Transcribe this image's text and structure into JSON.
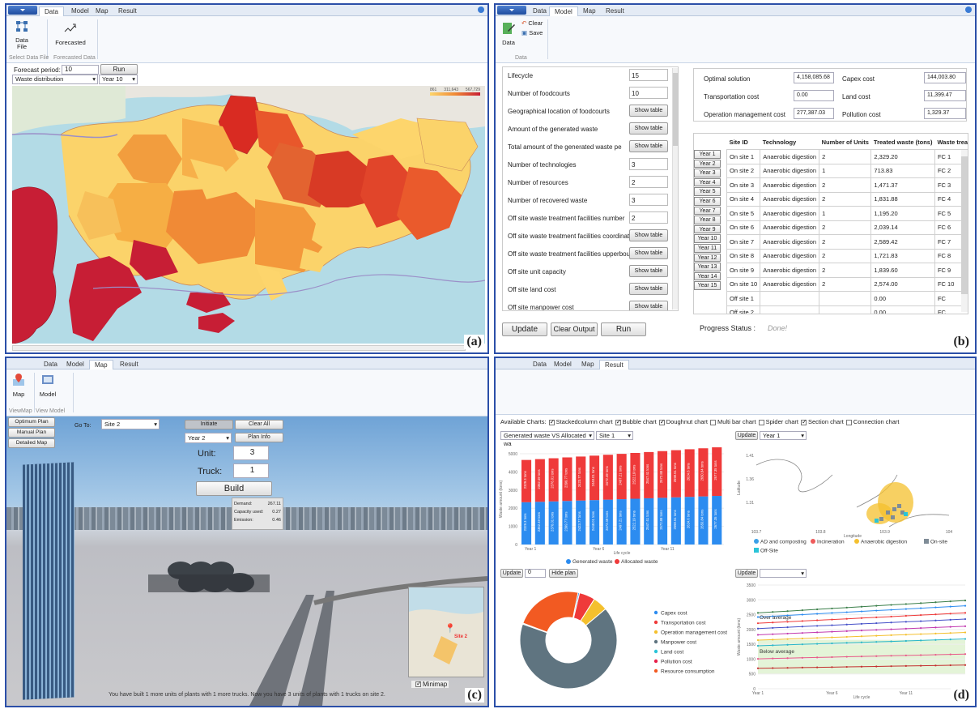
{
  "panel_a": {
    "tabs": [
      "Data",
      "Model",
      "Map",
      "Result"
    ],
    "ribbon": {
      "data_file": "Data\nFile",
      "forecasted": "Forecasted",
      "group1": "Select Data File",
      "group2": "Forecasted Data"
    },
    "forecast_label": "Forecast period:",
    "forecast_value": "10",
    "run": "Run",
    "dist_select": "Waste distribution",
    "year_select": "Year 10",
    "legend_ticks": [
      "861",
      "311,643",
      "567,729"
    ],
    "label": "(a)"
  },
  "panel_b": {
    "tabs": [
      "Data",
      "Model",
      "Map",
      "Result"
    ],
    "ribbon": {
      "data": "Data",
      "clear": "Clear",
      "save": "Save",
      "group": "Data"
    },
    "params": [
      {
        "label": "Lifecycle",
        "value": "15"
      },
      {
        "label": "Number of foodcourts",
        "value": "10"
      },
      {
        "label": "Geographical location of foodcourts",
        "button": "Show table"
      },
      {
        "label": "Amount of the generated waste",
        "button": "Show table"
      },
      {
        "label": "Total amount of the generated waste pe",
        "button": "Show table"
      },
      {
        "label": "Number of technologies",
        "value": "3"
      },
      {
        "label": "Number of resources",
        "value": "2"
      },
      {
        "label": "Number of recovered waste",
        "value": "3"
      },
      {
        "label": "Off site waste treatment facilities number",
        "value": "2"
      },
      {
        "label": "Off site waste treatment facilities coordinat",
        "button": "Show table"
      },
      {
        "label": "Off site waste treatment facilities upperbou",
        "button": "Show table"
      },
      {
        "label": "Off site unit capacity",
        "button": "Show table"
      },
      {
        "label": "Off site land cost",
        "button": "Show table"
      },
      {
        "label": "Off site manpower cost",
        "button": "Show table"
      }
    ],
    "costs": {
      "optimal_label": "Optimal solution",
      "optimal": "4,158,085.68",
      "capex_label": "Capex cost",
      "capex": "144,003.80",
      "transport_label": "Transportation cost",
      "transport": "0.00",
      "land_label": "Land cost",
      "land": "11,399.47",
      "operation_label": "Operation management cost",
      "operation": "277,387.03",
      "pollution_label": "Pollution cost",
      "pollution": "1,329.37"
    },
    "table_headers": [
      "Site ID",
      "Technology",
      "Number of Units",
      "Treated waste (tons)",
      "Waste treated from"
    ],
    "years": [
      "Year 1",
      "Year 2",
      "Year 3",
      "Year 4",
      "Year 5",
      "Year 6",
      "Year 7",
      "Year 8",
      "Year 9",
      "Year 10",
      "Year 11",
      "Year 12",
      "Year 13",
      "Year 14",
      "Year 15"
    ],
    "rows": [
      [
        "On site 1",
        "Anaerobic digestion",
        "2",
        "2,329.20",
        "FC 1"
      ],
      [
        "On site 2",
        "Anaerobic digestion",
        "1",
        "713.83",
        "FC 2"
      ],
      [
        "On site 3",
        "Anaerobic digestion",
        "2",
        "1,471.37",
        "FC 3"
      ],
      [
        "On site 4",
        "Anaerobic digestion",
        "2",
        "1,831.88",
        "FC 4"
      ],
      [
        "On site 5",
        "Anaerobic digestion",
        "1",
        "1,195.20",
        "FC 5"
      ],
      [
        "On site 6",
        "Anaerobic digestion",
        "2",
        "2,039.14",
        "FC 6"
      ],
      [
        "On site 7",
        "Anaerobic digestion",
        "2",
        "2,589.42",
        "FC 7"
      ],
      [
        "On site 8",
        "Anaerobic digestion",
        "2",
        "1,721.83",
        "FC 8"
      ],
      [
        "On site 9",
        "Anaerobic digestion",
        "2",
        "1,839.60",
        "FC 9"
      ],
      [
        "On site 10",
        "Anaerobic digestion",
        "2",
        "2,574.00",
        "FC 10"
      ],
      [
        "Off site 1",
        "",
        "",
        "0.00",
        "FC"
      ],
      [
        "Off site 2",
        "",
        "",
        "0.00",
        "FC"
      ]
    ],
    "update": "Update",
    "clear_output": "Clear Output",
    "run": "Run",
    "progress_label": "Progress Status :",
    "progress_value": "Done!",
    "label": "(b)"
  },
  "panel_c": {
    "tabs": [
      "Data",
      "Model",
      "Map",
      "Result"
    ],
    "ribbon": {
      "map": "Map",
      "model": "Model",
      "group1": "ViewMap",
      "group2": "View Model"
    },
    "left_buttons": [
      "Optimum Plan",
      "Manual Plan",
      "Detailed Map"
    ],
    "goto_label": "Go To:",
    "goto_value": "Site 2",
    "initiate": "Initiate",
    "clear_all": "Clear All",
    "year_value": "Year 2",
    "plan_info": "Plan Info",
    "unit_label": "Unit:",
    "unit_value": "3",
    "truck_label": "Truck:",
    "truck_value": "1",
    "build": "Build",
    "info": [
      {
        "k": "Demand:",
        "v": "267.11"
      },
      {
        "k": "Capacity used:",
        "v": "0.27"
      },
      {
        "k": "Emission:",
        "v": "0.46"
      }
    ],
    "minimap_label": "Minimap",
    "site_label": "Site 2",
    "status": "You have built 1 more units of plants with 1 more trucks. Now you have 3 units of plants with 1 trucks on site 2.",
    "label": "(c)"
  },
  "panel_d": {
    "tabs": [
      "Data",
      "Model",
      "Map",
      "Result"
    ],
    "available_label": "Available Charts:",
    "charts": [
      {
        "name": "Stackedcolumn chart",
        "on": true
      },
      {
        "name": "Bubble chart",
        "on": true
      },
      {
        "name": "Doughnut chart",
        "on": true
      },
      {
        "name": "Multi bar chart",
        "on": false
      },
      {
        "name": "Spider chart",
        "on": false
      },
      {
        "name": "Section chart",
        "on": true
      },
      {
        "name": "Connection chart",
        "on": false
      }
    ],
    "sel1": "Generated waste VS Allocated wa",
    "sel2": "Site 1",
    "update": "Update",
    "sel3": "Year 1",
    "update2": "Update",
    "num": "0",
    "hide_plan": "Hide plan",
    "update3": "Update",
    "label": "(d)"
  },
  "chart_data": [
    {
      "type": "bar",
      "title": "",
      "xlabel": "Life cycle",
      "ylabel": "Waste amount (tons)",
      "ylim": [
        0,
        5000
      ],
      "yticks": [
        "0",
        "1000",
        "2000",
        "3000",
        "4000",
        "5000"
      ],
      "xticks": [
        "Year 1",
        "Year 6",
        "Year 11"
      ],
      "categories": [
        "1",
        "2",
        "3",
        "4",
        "5",
        "6",
        "7",
        "8",
        "9",
        "10",
        "11",
        "12",
        "13",
        "14",
        "15"
      ],
      "series": [
        {
          "name": "Generated waste",
          "color": "#2c8cf0",
          "values": [
            2329.3,
            2352.49,
            2376.01,
            2399.77,
            2423.77,
            2448.01,
            2472.49,
            2497.21,
            2522.19,
            2547.41,
            2572.88,
            2598.61,
            2624.6,
            2650.84,
            2677.35
          ],
          "labels": [
            "2329.3 tons",
            "2352.49 tons",
            "2376.01 tons",
            "2399.77 tons",
            "2423.77 tons",
            "2448.01 tons",
            "2472.49 tons",
            "2497.21 tons",
            "2522.19 tons",
            "2547.41 tons",
            "2572.88 tons",
            "2598.61 tons",
            "2624.6 tons",
            "2650.84 tons",
            "2677.35 tons"
          ]
        },
        {
          "name": "Allocated waste",
          "color": "#ef3a3a",
          "values": [
            2329.3,
            2352.49,
            2376.01,
            2399.77,
            2423.77,
            2448.01,
            2472.49,
            2497.21,
            2522.19,
            2547.41,
            2572.88,
            2598.61,
            2624.6,
            2650.84,
            2677.35
          ],
          "labels": [
            "2329.3 tons",
            "2352.49 tons",
            "2376.01 tons",
            "2399.77 tons",
            "2423.77 tons",
            "2448.01 tons",
            "2472.49 tons",
            "2497.21 tons",
            "2522.19 tons",
            "2547.41 tons",
            "2572.88 tons",
            "2598.61 tons",
            "2624.6 tons",
            "2650.84 tons",
            "2677.35 tons"
          ]
        }
      ]
    },
    {
      "type": "scatter",
      "xlabel": "Longitude",
      "ylabel": "Latitude",
      "xlim": [
        103.7,
        104
      ],
      "ylim": [
        1.26,
        1.44
      ],
      "xticks": [
        "103.7",
        "103.8",
        "103.9",
        "104"
      ],
      "yticks": [
        "1.41",
        "1.36",
        "1.31"
      ],
      "legend": [
        {
          "name": "AD and composting",
          "color": "#3aa0e8"
        },
        {
          "name": "Incineration",
          "color": "#ef5a5a"
        },
        {
          "name": "Anaerobic digestion",
          "color": "#f4c02e"
        },
        {
          "name": "On-site",
          "color": "#7f8c97"
        },
        {
          "name": "Off-Site",
          "color": "#2bc4d8"
        }
      ]
    },
    {
      "type": "pie",
      "values": [
        0.5,
        5.3,
        4.9,
        66.5,
        0.3,
        0.03,
        22.5
      ],
      "legend": [
        {
          "name": "Capex cost",
          "color": "#2c8cf0"
        },
        {
          "name": "Transportation cost",
          "color": "#ef3a3a"
        },
        {
          "name": "Operation management cost",
          "color": "#f4c02e"
        },
        {
          "name": "Manpower cost",
          "color": "#5f7480"
        },
        {
          "name": "Land cost",
          "color": "#2bc4d8"
        },
        {
          "name": "Pollution cost",
          "color": "#e8204a"
        },
        {
          "name": "Resource consumption",
          "color": "#f25a22"
        }
      ]
    },
    {
      "type": "line",
      "xlabel": "Life cycle",
      "ylabel": "Waste amount (tons)",
      "ylim": [
        0,
        3500
      ],
      "yticks": [
        "0",
        "500",
        "1000",
        "1500",
        "2000",
        "2500",
        "3000",
        "3500"
      ],
      "xticks": [
        "Year 1",
        "Year 6",
        "Year 11"
      ],
      "annotations": [
        "Over average",
        "Below average"
      ],
      "series": [
        {
          "color": "#3b7f4a",
          "values": [
            2560,
            2978
          ]
        },
        {
          "color": "#2c8cf0",
          "values": [
            2420,
            2800
          ]
        },
        {
          "color": "#ef3a3a",
          "values": [
            2210,
            2560
          ]
        },
        {
          "color": "#4550c8",
          "values": [
            2030,
            2350
          ]
        },
        {
          "color": "#c23ab0",
          "values": [
            1820,
            2110
          ]
        },
        {
          "color": "#f4c02e",
          "values": [
            1640,
            1900
          ]
        },
        {
          "color": "#28b6c9",
          "values": [
            1450,
            1680
          ]
        },
        {
          "color": "#e85a8a",
          "values": [
            1010,
            1170
          ]
        },
        {
          "color": "#c43030",
          "values": [
            690,
            800
          ]
        }
      ]
    }
  ]
}
